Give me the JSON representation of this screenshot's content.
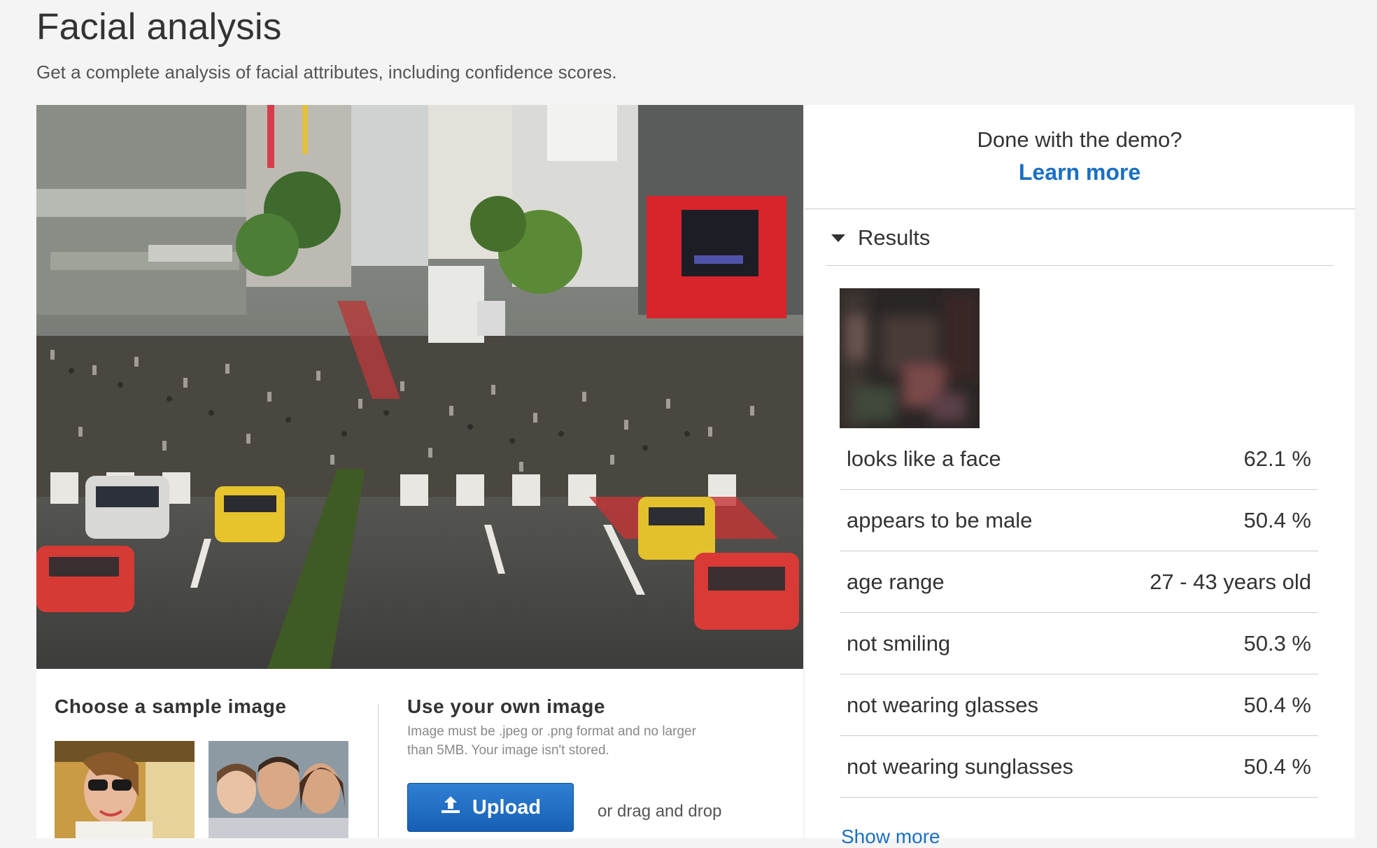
{
  "header": {
    "title": "Facial analysis",
    "subtitle": "Get a complete analysis of facial attributes, including confidence scores."
  },
  "samples": {
    "heading": "Choose a sample image",
    "thumbnails": [
      "sample-woman-sunglasses",
      "sample-family"
    ]
  },
  "upload": {
    "heading": "Use your own image",
    "note": "Image must be .jpeg or .png format and no larger than 5MB. Your image isn't stored.",
    "button_label": "Upload",
    "drag_text": "or drag and drop"
  },
  "demo_panel": {
    "question": "Done with the demo?",
    "learn_more": "Learn more"
  },
  "results": {
    "toggle_label": "Results",
    "rows": [
      {
        "label": "looks like a face",
        "value": "62.1 %"
      },
      {
        "label": "appears to be male",
        "value": "50.4 %"
      },
      {
        "label": "age range",
        "value": "27 - 43 years old"
      },
      {
        "label": "not smiling",
        "value": "50.3 %"
      },
      {
        "label": "not wearing glasses",
        "value": "50.4 %"
      },
      {
        "label": "not wearing sunglasses",
        "value": "50.4 %"
      }
    ],
    "show_more": "Show more"
  },
  "colors": {
    "accent": "#1a6fc4",
    "upload_button": "#1f6cc4"
  }
}
